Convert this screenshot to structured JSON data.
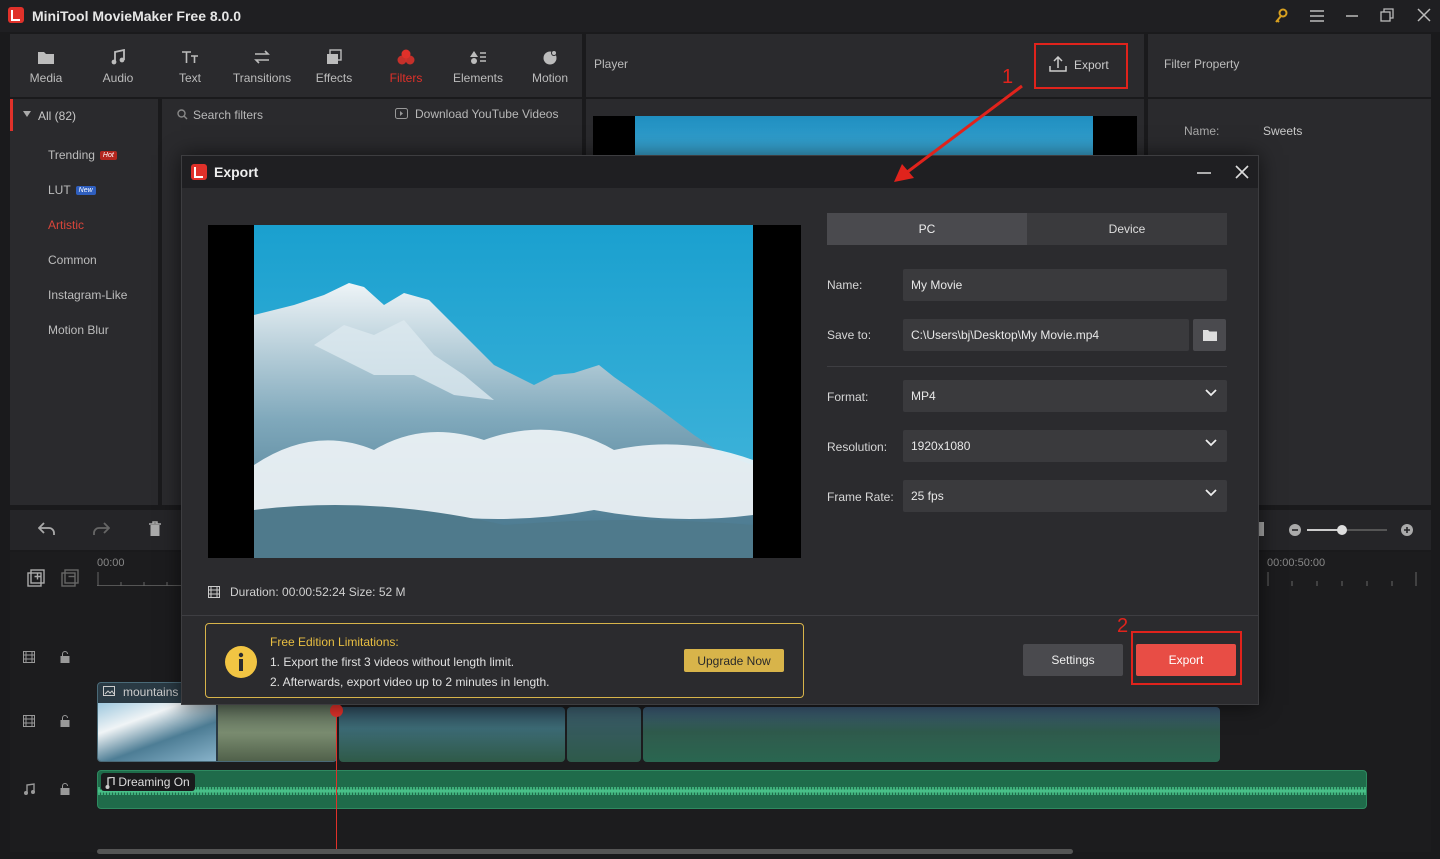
{
  "app": {
    "title": "MiniTool MovieMaker Free 8.0.0"
  },
  "toolbar": {
    "items": [
      {
        "label": "Media",
        "icon": "folder-icon"
      },
      {
        "label": "Audio",
        "icon": "music-note-icon"
      },
      {
        "label": "Text",
        "icon": "text-icon"
      },
      {
        "label": "Transitions",
        "icon": "transitions-icon"
      },
      {
        "label": "Effects",
        "icon": "effects-icon"
      },
      {
        "label": "Filters",
        "icon": "filters-icon",
        "active": true
      },
      {
        "label": "Elements",
        "icon": "elements-icon"
      },
      {
        "label": "Motion",
        "icon": "motion-icon"
      }
    ],
    "active_color": "#e0312a"
  },
  "sidebar": {
    "all_label": "All (82)",
    "items": [
      {
        "label": "Trending",
        "badge": "Hot"
      },
      {
        "label": "LUT",
        "badge": "New"
      },
      {
        "label": "Artistic"
      },
      {
        "label": "Common"
      },
      {
        "label": "Instagram-Like"
      },
      {
        "label": "Motion Blur"
      }
    ]
  },
  "filters_panel": {
    "search_placeholder": "Search filters",
    "download_label": "Download YouTube Videos"
  },
  "player": {
    "label": "Player",
    "export_label": "Export"
  },
  "property_panel": {
    "title": "Filter Property",
    "name_label": "Name:",
    "name_value": "Sweets"
  },
  "timeline": {
    "start_time": "00:00",
    "end_time": "00:00:50:00",
    "video_clip_label": "mountains",
    "audio_clip_label": "Dreaming On"
  },
  "export_dialog": {
    "title": "Export",
    "tabs": [
      {
        "label": "PC",
        "active": true
      },
      {
        "label": "Device",
        "active": false
      }
    ],
    "name_label": "Name:",
    "name_value": "My Movie",
    "save_label": "Save to:",
    "save_value": "C:\\Users\\bj\\Desktop\\My Movie.mp4",
    "format_label": "Format:",
    "format_value": "MP4",
    "resolution_label": "Resolution:",
    "resolution_value": "1920x1080",
    "framerate_label": "Frame Rate:",
    "framerate_value": "25 fps",
    "duration_label": "Duration:",
    "duration_value": "00:00:52:24",
    "size_label": "Size:",
    "size_value": "52 M",
    "limitations": {
      "title": "Free Edition Limitations:",
      "line1": "1. Export the first 3 videos without length limit.",
      "line2": "2. Afterwards, export video up to 2 minutes in length.",
      "upgrade_label": "Upgrade Now"
    },
    "settings_label": "Settings",
    "export_label": "Export"
  },
  "annotations": {
    "step1": "1",
    "step2": "2",
    "color": "#e0231c"
  }
}
